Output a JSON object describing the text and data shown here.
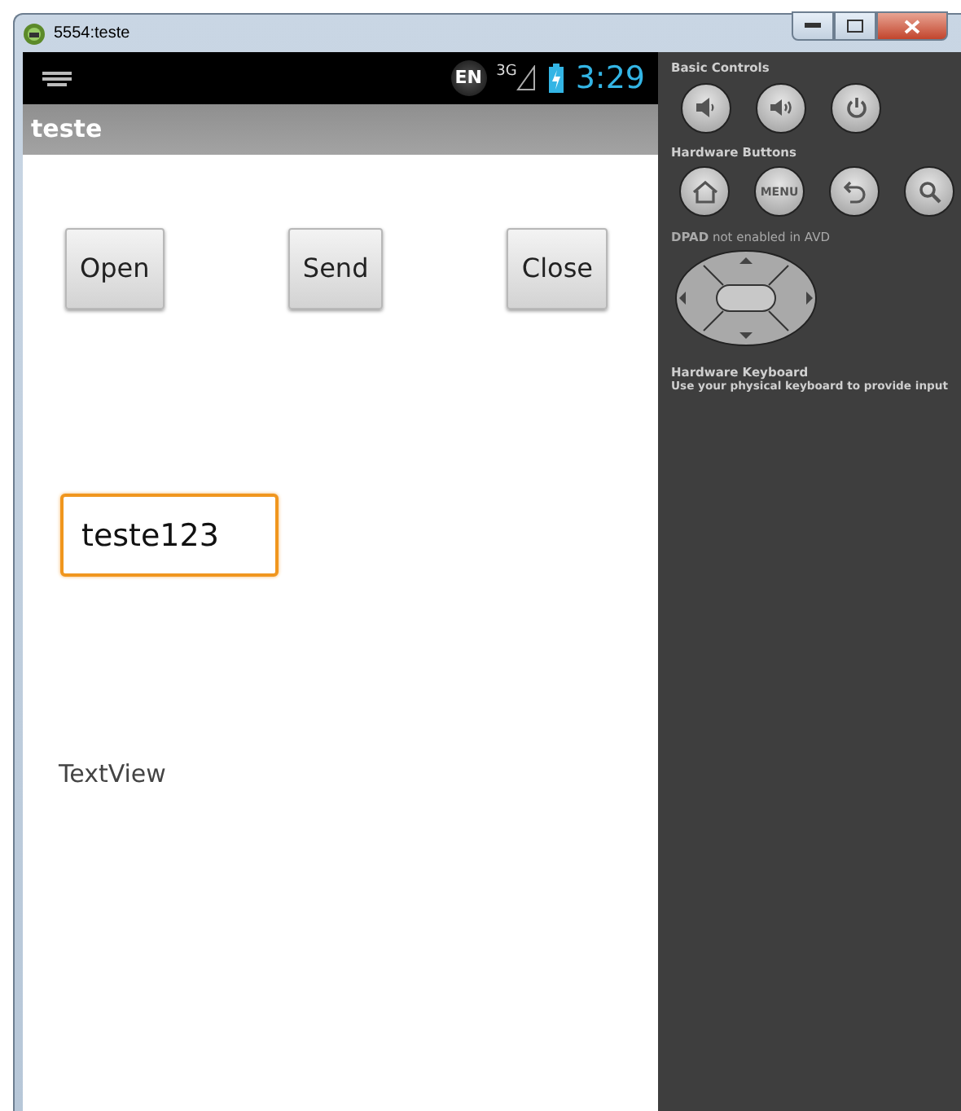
{
  "window": {
    "title": "5554:teste"
  },
  "status_bar": {
    "language": "EN",
    "network": "3G",
    "time": "3:29"
  },
  "app": {
    "title": "teste",
    "buttons": [
      "Open",
      "Send",
      "Close"
    ],
    "field": {
      "value": "teste123",
      "focused": true
    },
    "text_view": "TextView"
  },
  "controls": {
    "basic_title": "Basic Controls",
    "hardware_title": "Hardware Buttons",
    "menu_label": "MENU",
    "dpad_note": "**DPAD** not enabled in AVD",
    "keyboard_title": "Hardware Keyboard",
    "keyboard_note": "Use your physical keyboard to provide input"
  }
}
